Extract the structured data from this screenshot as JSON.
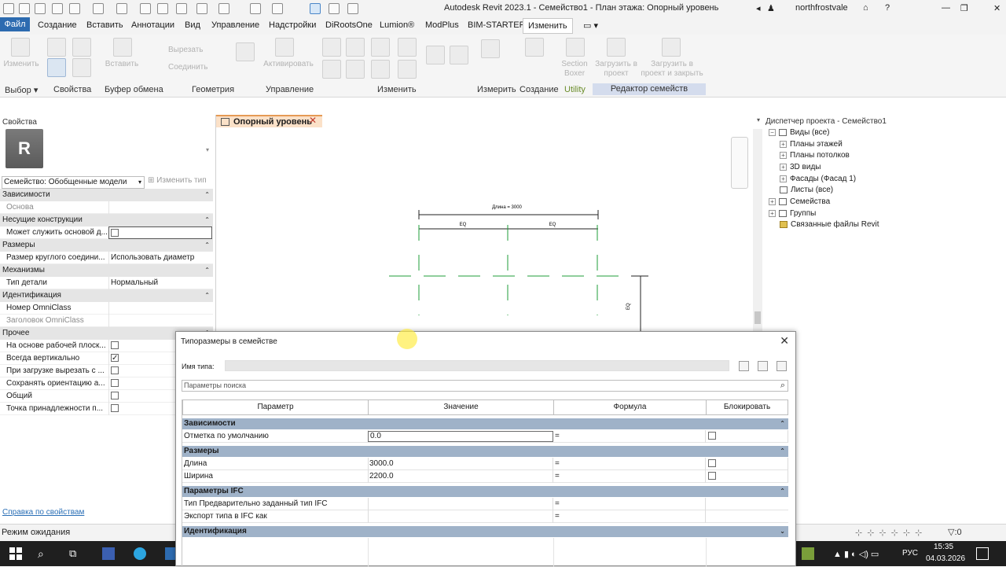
{
  "app": {
    "title": "Autodesk Revit 2023.1 - Семейство1 - План этажа: Опорный уровень",
    "user": "northfrostvale"
  },
  "menu": {
    "file": "Файл",
    "tabs": [
      "Создание",
      "Вставить",
      "Аннотации",
      "Вид",
      "Управление",
      "Надстройки",
      "DiRootsOne",
      "Lumion®",
      "ModPlus",
      "BIM-STARTER",
      "Изменить"
    ]
  },
  "ribbon": {
    "buttons": {
      "modify": "Изменить",
      "paste": "Вставить",
      "cut": "Вырезать",
      "join": "Соединить",
      "activate": "Активировать",
      "section_box": "Section Boxer",
      "load_project": "Загрузить в проект",
      "load_close": "Загрузить в проект и закрыть"
    },
    "panels": [
      "Выбор",
      "Свойства",
      "Буфер обмена",
      "Геометрия",
      "Управление",
      "Изменить",
      "Измерить",
      "Создание",
      "Utility",
      "Редактор семейств"
    ]
  },
  "properties": {
    "title": "Свойства",
    "logo": "R",
    "family_selector": "Семейство: Обобщенные модели",
    "edit_type": "Изменить тип",
    "groups": {
      "constraints": "Зависимости",
      "structural": "Несущие конструкции",
      "dimensions": "Размеры",
      "mechanisms": "Механизмы",
      "identification": "Идентификация",
      "other": "Прочее"
    },
    "rows": {
      "base": "Основа",
      "can_host": "Может служить основой д...",
      "round_conn": "Размер круглого соедини...",
      "round_conn_val": "Использовать диаметр",
      "part_type": "Тип детали",
      "part_type_val": "Нормальный",
      "omni_num": "Номер OmniClass",
      "omni_title": "Заголовок OmniClass",
      "workplane": "На основе рабочей плоск...",
      "always_vertical": "Всегда вертикально",
      "cut_on_load": "При загрузке вырезать с ...",
      "keep_orient": "Сохранять ориентацию а...",
      "shared": "Общий",
      "room_point": "Точка принадлежности п..."
    },
    "help": "Справка по свойствам"
  },
  "view": {
    "tab": "Опорный уровень",
    "dim_total": "Длина = 3000",
    "eq": "EQ"
  },
  "browser": {
    "title": "Диспетчер проекта - Семейство1",
    "items": [
      "Виды (все)",
      "Планы этажей",
      "Планы потолков",
      "3D виды",
      "Фасады (Фасад 1)",
      "Листы (все)",
      "Семейства",
      "Группы",
      "Связанные файлы Revit"
    ]
  },
  "status": {
    "text": "Режим ожидания"
  },
  "taskbar": {
    "lang": "РУС",
    "time": "15:35",
    "date": "04.03.2026"
  },
  "dialog": {
    "title": "Типоразмеры в семействе",
    "type_name_label": "Имя типа:",
    "search_placeholder": "Параметры поиска",
    "columns": [
      "Параметр",
      "Значение",
      "Формула",
      "Блокировать"
    ],
    "groups": {
      "constraints": "Зависимости",
      "dimensions": "Размеры",
      "ifc": "Параметры IFC",
      "identification": "Идентификация"
    },
    "rows": {
      "default_elev": "Отметка по умолчанию",
      "default_elev_val": "0.0",
      "length": "Длина",
      "length_val": "3000.0",
      "width": "Ширина",
      "width_val": "2200.0",
      "ifc_type": "Тип Предварительно заданный тип IFC",
      "ifc_export": "Экспорт типа в IFC как",
      "eq_sign": "="
    }
  }
}
